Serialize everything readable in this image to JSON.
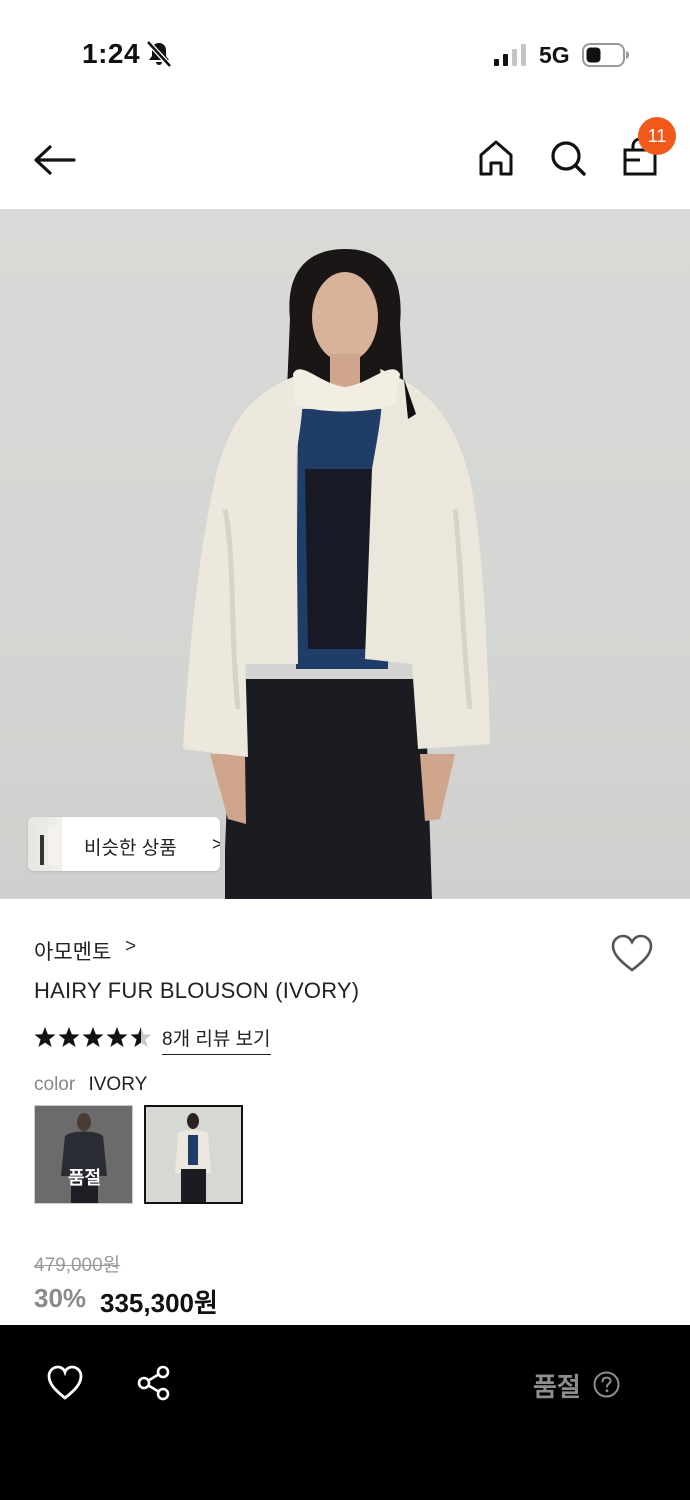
{
  "status_bar": {
    "time": "1:24",
    "network": "5G"
  },
  "header": {
    "cart_count": "11",
    "icons": [
      "back-arrow-icon",
      "home-icon",
      "search-icon",
      "shopping-bag-icon"
    ]
  },
  "image": {
    "similar_label": "비슷한 상품"
  },
  "product": {
    "brand": "아모멘토",
    "name": "HAIRY FUR BLOUSON (IVORY)",
    "rating": 4.5,
    "review_link": "8개 리뷰 보기",
    "color_label": "color",
    "color_value": "IVORY",
    "swatch_soldout": "품절",
    "original_price": "479,000원",
    "discount": "30%",
    "final_price": "335,300원"
  },
  "bottom_bar": {
    "soldout_label": "품절",
    "icons": [
      "heart-icon",
      "share-icon",
      "help-circle-icon"
    ]
  },
  "colors": {
    "badge": "#f25a1c",
    "bottom_bar_bg": "#000000",
    "bottom_label": "#8d8d8d"
  }
}
